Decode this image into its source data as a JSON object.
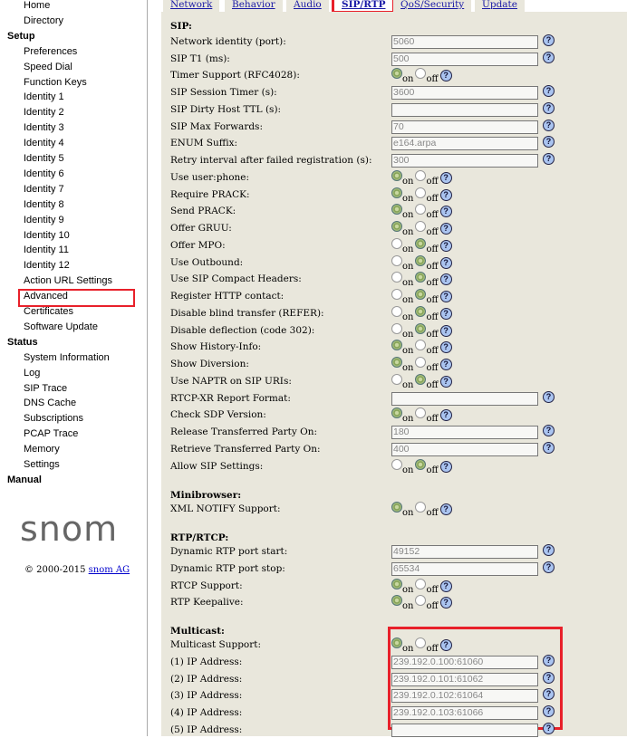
{
  "sidebar": {
    "items": [
      {
        "label": "Home",
        "type": "item"
      },
      {
        "label": "Directory",
        "type": "item"
      },
      {
        "label": "Setup",
        "type": "header"
      },
      {
        "label": "Preferences",
        "type": "item"
      },
      {
        "label": "Speed Dial",
        "type": "item"
      },
      {
        "label": "Function Keys",
        "type": "item"
      },
      {
        "label": "Identity 1",
        "type": "item"
      },
      {
        "label": "Identity 2",
        "type": "item"
      },
      {
        "label": "Identity 3",
        "type": "item"
      },
      {
        "label": "Identity 4",
        "type": "item"
      },
      {
        "label": "Identity 5",
        "type": "item"
      },
      {
        "label": "Identity 6",
        "type": "item"
      },
      {
        "label": "Identity 7",
        "type": "item"
      },
      {
        "label": "Identity 8",
        "type": "item"
      },
      {
        "label": "Identity 9",
        "type": "item"
      },
      {
        "label": "Identity 10",
        "type": "item"
      },
      {
        "label": "Identity 11",
        "type": "item"
      },
      {
        "label": "Identity 12",
        "type": "item"
      },
      {
        "label": "Action URL Settings",
        "type": "item"
      },
      {
        "label": "Advanced",
        "type": "item"
      },
      {
        "label": "Certificates",
        "type": "item"
      },
      {
        "label": "Software Update",
        "type": "item"
      },
      {
        "label": "Status",
        "type": "header"
      },
      {
        "label": "System Information",
        "type": "item"
      },
      {
        "label": "Log",
        "type": "item"
      },
      {
        "label": "SIP Trace",
        "type": "item"
      },
      {
        "label": "DNS Cache",
        "type": "item"
      },
      {
        "label": "Subscriptions",
        "type": "item"
      },
      {
        "label": "PCAP Trace",
        "type": "item"
      },
      {
        "label": "Memory",
        "type": "item"
      },
      {
        "label": "Settings",
        "type": "item"
      },
      {
        "label": "Manual",
        "type": "header"
      }
    ],
    "logo": "snom",
    "copyright": "© 2000-2015",
    "copyright_link": "snom AG"
  },
  "tabs": [
    {
      "label": "Network"
    },
    {
      "label": "Behavior"
    },
    {
      "label": "Audio"
    },
    {
      "label": "SIP/RTP",
      "active": true
    },
    {
      "label": "QoS/Security"
    },
    {
      "label": "Update"
    }
  ],
  "radio_labels": {
    "on": "on",
    "off": "off"
  },
  "help_glyph": "?",
  "sections": [
    {
      "title": "SIP:",
      "rows": [
        {
          "label": "Network identity (port):",
          "type": "text",
          "value": "5060"
        },
        {
          "label": "SIP T1 (ms):",
          "type": "text",
          "value": "500"
        },
        {
          "label": "Timer Support (RFC4028):",
          "type": "radio",
          "value": "on"
        },
        {
          "label": "SIP Session Timer (s):",
          "type": "text",
          "value": "3600"
        },
        {
          "label": "SIP Dirty Host TTL (s):",
          "type": "text",
          "value": ""
        },
        {
          "label": "SIP Max Forwards:",
          "type": "text",
          "value": "70"
        },
        {
          "label": "ENUM Suffix:",
          "type": "text",
          "value": "e164.arpa"
        },
        {
          "label": "Retry interval after failed registration (s):",
          "type": "text",
          "value": "300"
        },
        {
          "label": "Use user:phone:",
          "type": "radio",
          "value": "on"
        },
        {
          "label": "Require PRACK:",
          "type": "radio",
          "value": "on"
        },
        {
          "label": "Send PRACK:",
          "type": "radio",
          "value": "on"
        },
        {
          "label": "Offer GRUU:",
          "type": "radio",
          "value": "on"
        },
        {
          "label": "Offer MPO:",
          "type": "radio",
          "value": "off"
        },
        {
          "label": "Use Outbound:",
          "type": "radio",
          "value": "off"
        },
        {
          "label": "Use SIP Compact Headers:",
          "type": "radio",
          "value": "off"
        },
        {
          "label": "Register HTTP contact:",
          "type": "radio",
          "value": "off"
        },
        {
          "label": "Disable blind transfer (REFER):",
          "type": "radio",
          "value": "off"
        },
        {
          "label": "Disable deflection (code 302):",
          "type": "radio",
          "value": "off"
        },
        {
          "label": "Show History-Info:",
          "type": "radio",
          "value": "on"
        },
        {
          "label": "Show Diversion:",
          "type": "radio",
          "value": "on"
        },
        {
          "label": "Use NAPTR on SIP URIs:",
          "type": "radio",
          "value": "off"
        },
        {
          "label": "RTCP-XR Report Format:",
          "type": "text",
          "value": ""
        },
        {
          "label": "Check SDP Version:",
          "type": "radio",
          "value": "on"
        },
        {
          "label": "Release Transferred Party On:",
          "type": "text",
          "value": "180"
        },
        {
          "label": "Retrieve Transferred Party On:",
          "type": "text",
          "value": "400"
        },
        {
          "label": "Allow SIP Settings:",
          "type": "radio",
          "value": "off"
        }
      ]
    },
    {
      "title": "Minibrowser:",
      "rows": [
        {
          "label": "XML NOTIFY Support:",
          "type": "radio",
          "value": "on"
        }
      ]
    },
    {
      "title": "RTP/RTCP:",
      "rows": [
        {
          "label": "Dynamic RTP port start:",
          "type": "text",
          "value": "49152"
        },
        {
          "label": "Dynamic RTP port stop:",
          "type": "text",
          "value": "65534"
        },
        {
          "label": "RTCP Support:",
          "type": "radio",
          "value": "on"
        },
        {
          "label": "RTP Keepalive:",
          "type": "radio",
          "value": "on"
        }
      ]
    },
    {
      "title": "Multicast:",
      "rows": [
        {
          "label": "Multicast Support:",
          "type": "radio",
          "value": "on"
        },
        {
          "label": "(1) IP Address:",
          "type": "text",
          "value": "239.192.0.100:61060"
        },
        {
          "label": "(2) IP Address:",
          "type": "text",
          "value": "239.192.0.101:61062"
        },
        {
          "label": "(3) IP Address:",
          "type": "text",
          "value": "239.192.0.102:61064"
        },
        {
          "label": "(4) IP Address:",
          "type": "text",
          "value": "239.192.0.103:61066"
        },
        {
          "label": "(5) IP Address:",
          "type": "text",
          "value": ""
        }
      ]
    }
  ]
}
